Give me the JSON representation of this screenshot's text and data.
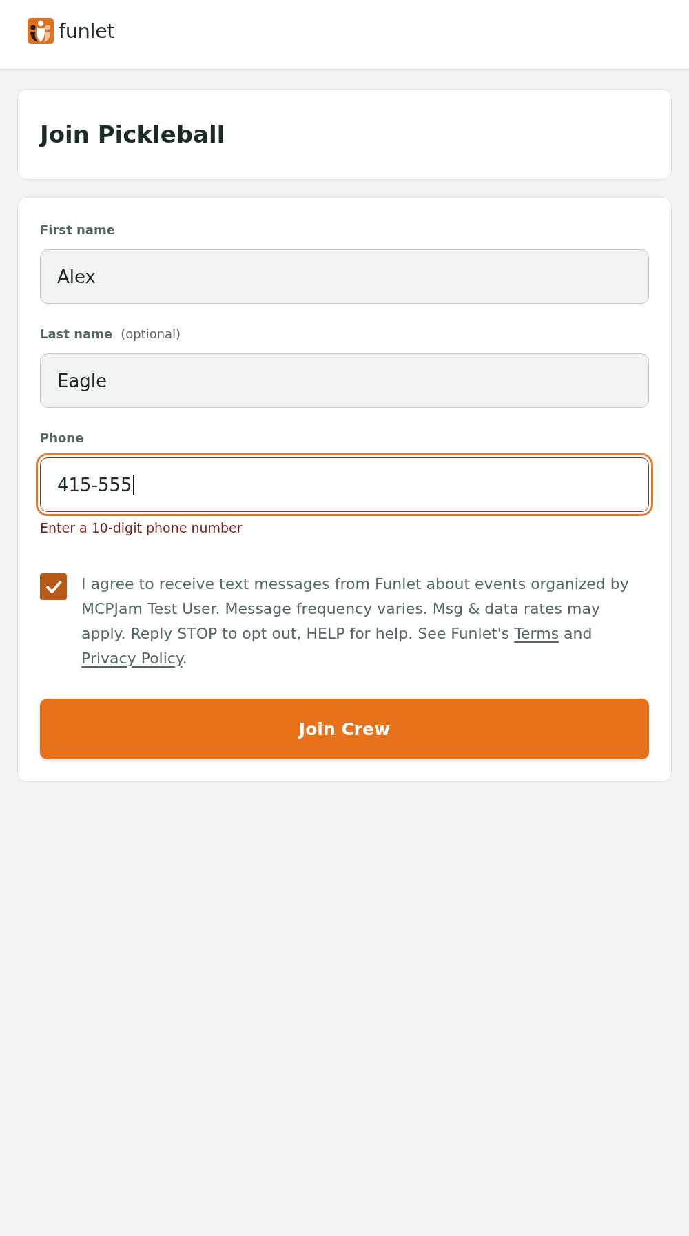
{
  "header": {
    "logo": {
      "text": "funlet"
    }
  },
  "title_card": {
    "title": "Join Pickleball"
  },
  "form": {
    "fields": [
      {
        "label": "First name",
        "value": "Alex",
        "focused": false
      },
      {
        "label": "Last name",
        "hint": "(optional)",
        "value": "Eagle",
        "focused": false
      },
      {
        "label": "Phone",
        "value": "415-555",
        "focused": true,
        "error": "Enter a 10-digit phone number"
      }
    ],
    "consent": {
      "checked": true,
      "parts": [
        {
          "kind": "text",
          "text": "I agree to receive text messages from Funlet about events organized by MCPJam Test User. Message frequency varies. Msg & data rates may apply. Reply STOP to opt out, HELP for help. See Funlet's "
        },
        {
          "kind": "link",
          "text": "Terms"
        },
        {
          "kind": "text",
          "text": " and "
        },
        {
          "kind": "link",
          "text": "Privacy Policy"
        },
        {
          "kind": "text",
          "text": "."
        }
      ]
    },
    "submit": {
      "label": "Join Crew"
    }
  }
}
